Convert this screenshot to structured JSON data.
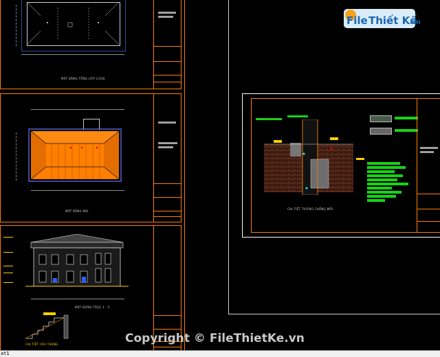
{
  "watermark": {
    "logo_text_1": "File",
    "logo_text_2": "Thiết Kế",
    "logo_suffix": ".vn",
    "copyright": "Copyright © FileThietKe.vn"
  },
  "sheets": {
    "roof_plan": {
      "caption": "MẶT BẰNG TỔNG LỚP 1/100"
    },
    "roof_view": {
      "caption": "MẶT BẰNG MÁI"
    },
    "elevation": {
      "caption": "MẶT ĐỨNG TRỤC 1 - 5"
    },
    "stair": {
      "caption": "CHI TIẾT CẦU THANG"
    },
    "detail": {
      "caption": "CHI TIẾT TƯỜNG CHỐNG MỐI"
    }
  },
  "status": {
    "command_text": "at1"
  },
  "colors": {
    "frame": "#ff7f00",
    "annotation": "#16d416",
    "roof": "#ff7f00",
    "building_edge": "#3a4aa0"
  }
}
